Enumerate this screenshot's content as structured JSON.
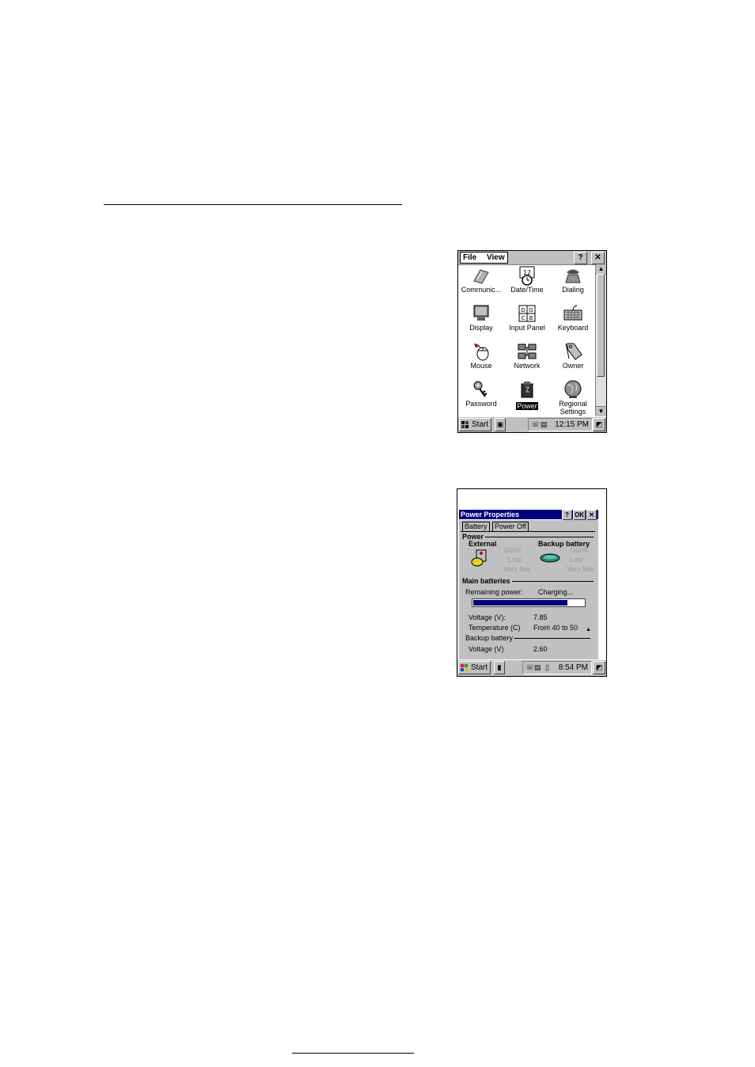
{
  "control_panel": {
    "menu": [
      "File",
      "View"
    ],
    "buttons": {
      "help": "?",
      "close": "✕"
    },
    "icons": [
      {
        "label": "Communic...",
        "icon": "communication-icon"
      },
      {
        "label": "Date/Time",
        "icon": "calendar-clock-icon"
      },
      {
        "label": "Dialing",
        "icon": "telephone-icon"
      },
      {
        "label": "Display",
        "icon": "monitor-icon"
      },
      {
        "label": "Input Panel",
        "icon": "input-panel-icon"
      },
      {
        "label": "Keyboard",
        "icon": "keyboard-icon"
      },
      {
        "label": "Mouse",
        "icon": "mouse-icon"
      },
      {
        "label": "Network",
        "icon": "network-icon"
      },
      {
        "label": "Owner",
        "icon": "owner-tag-icon"
      },
      {
        "label": "Password",
        "icon": "keys-icon"
      },
      {
        "label": "Power",
        "icon": "power-icon",
        "selected": true
      },
      {
        "label": "Regional Settings",
        "icon": "globe-icon"
      }
    ],
    "taskbar": {
      "start": "Start",
      "clock": "12:15 PM"
    }
  },
  "power_properties": {
    "title": "Power Properties",
    "buttons": {
      "help": "?",
      "ok": "OK",
      "close": "✕"
    },
    "tabs": [
      "Battery",
      "Power Off"
    ],
    "power_group": "Power",
    "external_label": "External",
    "backup_label": "Backup battery",
    "external_levels": [
      "Good",
      "Low",
      "Very low"
    ],
    "backup_levels": [
      "Good",
      "Low",
      "Very low"
    ],
    "main_group": "Main batteries",
    "remaining_label": "Remaining power:",
    "remaining_value": "Charging...",
    "remaining_level": 0.85,
    "voltage_label": "Voltage (V):",
    "voltage_value": "7.85",
    "temperature_label": "Temperature (C)",
    "temperature_value": "From 40 to 50",
    "backup_group": "Backup battery",
    "backup_voltage_label": "Voltage (V)",
    "backup_voltage_value": "2.60",
    "taskbar": {
      "start": "Start",
      "clock": "8:54 PM"
    }
  },
  "colors": {
    "titlebar": "#000080",
    "progress": "#000080",
    "face": "#c0c0c0"
  }
}
